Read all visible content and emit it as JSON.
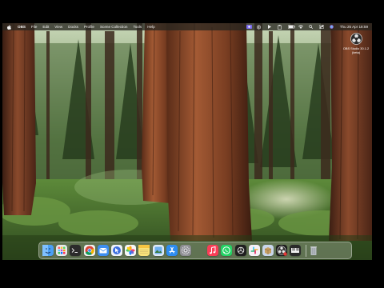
{
  "menubar": {
    "app_name": "OBS",
    "menus": [
      "File",
      "Edit",
      "View",
      "Docks",
      "Profile",
      "Scene Collection",
      "Tools",
      "Help"
    ],
    "clock": "Thu 25 Apr  18:59",
    "status_icons": [
      "obs-recording-icon",
      "bluetooth-icon",
      "play-icon",
      "clipboard-icon",
      "battery-icon",
      "wifi-icon",
      "search-icon",
      "control-center-icon",
      "siri-icon"
    ]
  },
  "desktop": {
    "wallpaper": "Redwood forest",
    "icons": [
      {
        "label_line1": "OBS Studio 30.1.2",
        "label_line2": "(beta)",
        "icon": "obs-studio-icon"
      }
    ]
  },
  "dock": {
    "apps": [
      {
        "icon": "finder-icon",
        "color": "#4a9ff5"
      },
      {
        "icon": "launchpad-icon",
        "color": "#e8e8ec"
      },
      {
        "icon": "terminal-icon",
        "color": "#2b2b2b"
      },
      {
        "icon": "chrome-icon",
        "color": "#f1f1f1"
      },
      {
        "icon": "mail-icon",
        "color": "#3d8ef0"
      },
      {
        "icon": "cursor-icon",
        "color": "#eef2f8"
      },
      {
        "icon": "photos-icon",
        "color": "#f6f6f6"
      },
      {
        "icon": "notes-icon",
        "color": "#f7e27a"
      },
      {
        "icon": "preview-icon",
        "color": "#dfeaf6"
      },
      {
        "icon": "app-store-icon",
        "color": "#2d8cf0"
      },
      {
        "icon": "system-settings-icon",
        "color": "#8e8e93"
      },
      {
        "icon": "empty-slot-icon",
        "color": "transparent"
      },
      {
        "icon": "music-icon",
        "color": "#fa3e57"
      },
      {
        "icon": "whatsapp-icon",
        "color": "#25d366"
      },
      {
        "icon": "chatgpt-icon",
        "color": "#1f1f1f"
      },
      {
        "icon": "slack-icon",
        "color": "#f4f0f6"
      },
      {
        "icon": "installer-icon",
        "color": "#c9d6ea"
      },
      {
        "icon": "obs-studio-icon",
        "color": "#1c1c1c"
      },
      {
        "icon": "piano-icon",
        "color": "#2a2a2a"
      }
    ],
    "trash": {
      "icon": "trash-icon",
      "color": "#9aa0a6"
    }
  }
}
